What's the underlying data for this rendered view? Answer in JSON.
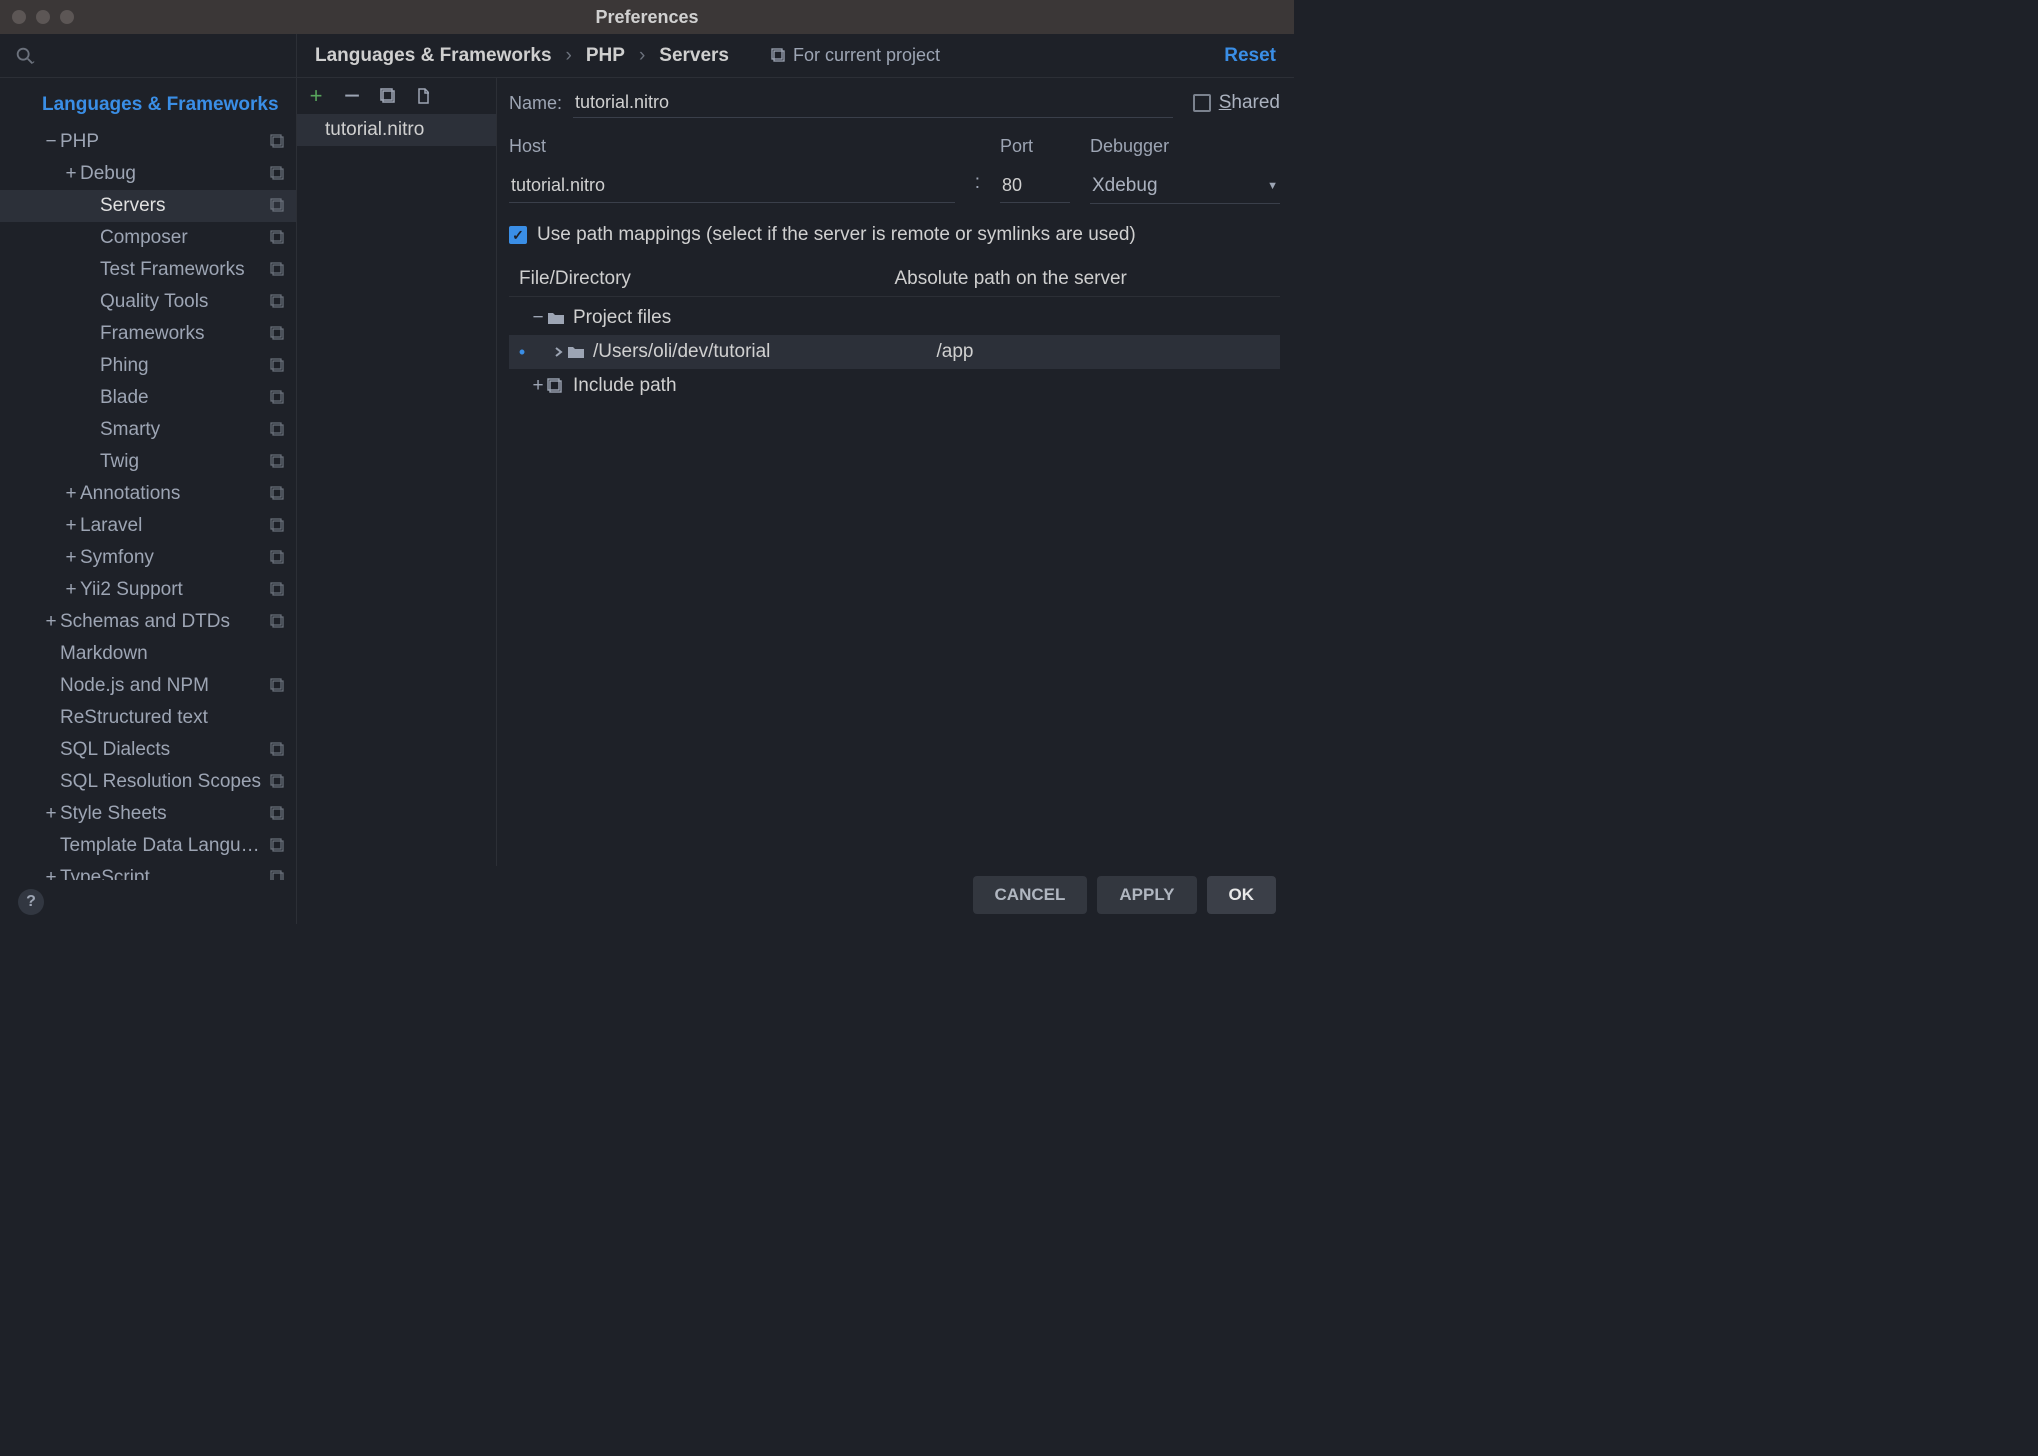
{
  "window": {
    "title": "Preferences"
  },
  "breadcrumb": {
    "a": "Languages & Frameworks",
    "b": "PHP",
    "c": "Servers",
    "scope": "For current project",
    "reset": "Reset"
  },
  "sidebar": {
    "heading": "Languages & Frameworks",
    "items": [
      {
        "label": "PHP",
        "indent": 1,
        "exp": "minus",
        "suffix": true
      },
      {
        "label": "Debug",
        "indent": 2,
        "exp": "plus",
        "suffix": true
      },
      {
        "label": "Servers",
        "indent": 3,
        "exp": "",
        "suffix": true,
        "selected": true
      },
      {
        "label": "Composer",
        "indent": 3,
        "exp": "",
        "suffix": true
      },
      {
        "label": "Test Frameworks",
        "indent": 3,
        "exp": "",
        "suffix": true
      },
      {
        "label": "Quality Tools",
        "indent": 3,
        "exp": "",
        "suffix": true
      },
      {
        "label": "Frameworks",
        "indent": 3,
        "exp": "",
        "suffix": true
      },
      {
        "label": "Phing",
        "indent": 3,
        "exp": "",
        "suffix": true
      },
      {
        "label": "Blade",
        "indent": 3,
        "exp": "",
        "suffix": true
      },
      {
        "label": "Smarty",
        "indent": 3,
        "exp": "",
        "suffix": true
      },
      {
        "label": "Twig",
        "indent": 3,
        "exp": "",
        "suffix": true
      },
      {
        "label": "Annotations",
        "indent": 2,
        "exp": "plus",
        "suffix": true
      },
      {
        "label": "Laravel",
        "indent": 2,
        "exp": "plus",
        "suffix": true
      },
      {
        "label": "Symfony",
        "indent": 2,
        "exp": "plus",
        "suffix": true
      },
      {
        "label": "Yii2 Support",
        "indent": 2,
        "exp": "plus",
        "suffix": true
      },
      {
        "label": "Schemas and DTDs",
        "indent": 1,
        "exp": "plus",
        "suffix": true
      },
      {
        "label": "Markdown",
        "indent": 1,
        "exp": "",
        "suffix": false
      },
      {
        "label": "Node.js and NPM",
        "indent": 1,
        "exp": "",
        "suffix": true
      },
      {
        "label": "ReStructured text",
        "indent": 1,
        "exp": "",
        "suffix": false
      },
      {
        "label": "SQL Dialects",
        "indent": 1,
        "exp": "",
        "suffix": true
      },
      {
        "label": "SQL Resolution Scopes",
        "indent": 1,
        "exp": "",
        "suffix": true
      },
      {
        "label": "Style Sheets",
        "indent": 1,
        "exp": "plus",
        "suffix": true
      },
      {
        "label": "Template Data Languages",
        "indent": 1,
        "exp": "",
        "suffix": true
      },
      {
        "label": "TypeScript",
        "indent": 1,
        "exp": "plus",
        "suffix": true
      }
    ]
  },
  "servers": {
    "list": [
      {
        "name": "tutorial.nitro"
      }
    ]
  },
  "form": {
    "name_label": "Name:",
    "name_value": "tutorial.nitro",
    "shared_label": "Shared",
    "host_label": "Host",
    "host_value": "tutorial.nitro",
    "port_label": "Port",
    "port_value": "80",
    "debugger_label": "Debugger",
    "debugger_value": "Xdebug",
    "pathmap_label": "Use path mappings (select if the server is remote or symlinks are used)",
    "table": {
      "col_file": "File/Directory",
      "col_abs": "Absolute path on the server",
      "rows": [
        {
          "kind": "group",
          "exp": "minus",
          "icon": "folder",
          "label": "Project files",
          "abs": "",
          "indent": 0
        },
        {
          "kind": "path",
          "exp": "chev",
          "icon": "folder",
          "label": "/Users/oli/dev/tutorial",
          "abs": "/app",
          "indent": 1,
          "selected": true,
          "bullet": true
        },
        {
          "kind": "group",
          "exp": "plus",
          "icon": "stack",
          "label": "Include path",
          "abs": "",
          "indent": 0
        }
      ]
    }
  },
  "buttons": {
    "cancel": "CANCEL",
    "apply": "APPLY",
    "ok": "OK"
  }
}
